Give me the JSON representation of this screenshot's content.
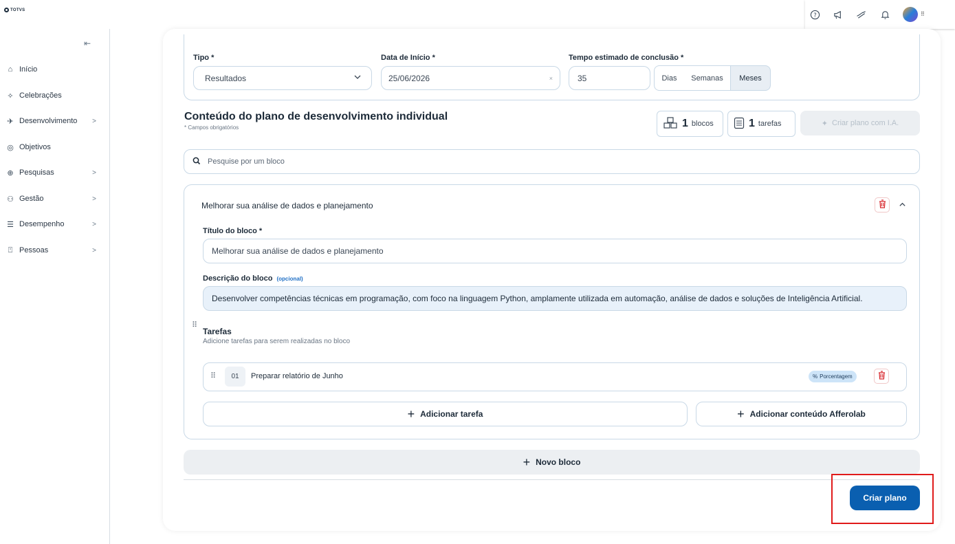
{
  "brand": {
    "logo_text": "TOTVS"
  },
  "header": {
    "icons": [
      "help-icon",
      "megaphone-icon",
      "hand-icon",
      "bell-icon"
    ],
    "more_label": "⠿"
  },
  "sidebar": {
    "collapse_icon": "⇤",
    "items": [
      {
        "label": "Início",
        "icon": "⌂",
        "has_children": false
      },
      {
        "label": "Celebrações",
        "icon": "✧",
        "has_children": false
      },
      {
        "label": "Desenvolvimento",
        "icon": "✈",
        "has_children": true
      },
      {
        "label": "Objetivos",
        "icon": "◎",
        "has_children": false
      },
      {
        "label": "Pesquisas",
        "icon": "⊕",
        "has_children": true
      },
      {
        "label": "Gestão",
        "icon": "⚇",
        "has_children": true
      },
      {
        "label": "Desempenho",
        "icon": "☰",
        "has_children": true
      },
      {
        "label": "Pessoas",
        "icon": "⍞",
        "has_children": true
      }
    ]
  },
  "form": {
    "tipo_label": "Tipo *",
    "tipo_value": "Resultados",
    "data_label": "Data de Início  *",
    "data_value": "25/06/2026",
    "tempo_label": "Tempo estimado de conclusão  *",
    "tempo_value": "35",
    "units": [
      "Dias",
      "Semanas",
      "Meses"
    ],
    "selected_unit": "Meses"
  },
  "content": {
    "title": "Conteúdo do plano de desenvolvimento individual",
    "subtitle": "* Campos obrigatórios",
    "blocks_count": "1",
    "blocks_label": "blocos",
    "tasks_count": "1",
    "tasks_label": "tarefas",
    "ai_button": "Criar plano com I.A.",
    "search_placeholder": "Pesquise por um bloco"
  },
  "block": {
    "header": "Melhorar sua análise de dados e planejamento",
    "title_label": "Título do bloco  *",
    "title_value": "Melhorar sua análise de dados e planejamento",
    "desc_label": "Descrição do bloco",
    "desc_optional": "(opcional)",
    "desc_value": "Desenvolver competências técnicas em programação, com foco na linguagem Python, amplamente utilizada em automação, análise de dados e soluções de Inteligência Artificial.",
    "tasks_title": "Tarefas",
    "tasks_sub": "Adicione tarefas para serem realizadas no bloco",
    "tasks": [
      {
        "num": "01",
        "name": "Preparar relatório de Junho",
        "tag": "Porcentagem"
      }
    ],
    "add_task": "Adicionar tarefa",
    "add_afferolab": "Adicionar conteúdo Afferolab"
  },
  "actions": {
    "new_block": "Novo bloco",
    "create_plan": "Criar plano"
  },
  "colors": {
    "primary": "#0a5fb0",
    "border": "#c8d8e6",
    "danger": "#d8242a",
    "highlight": "#e01a1a"
  }
}
